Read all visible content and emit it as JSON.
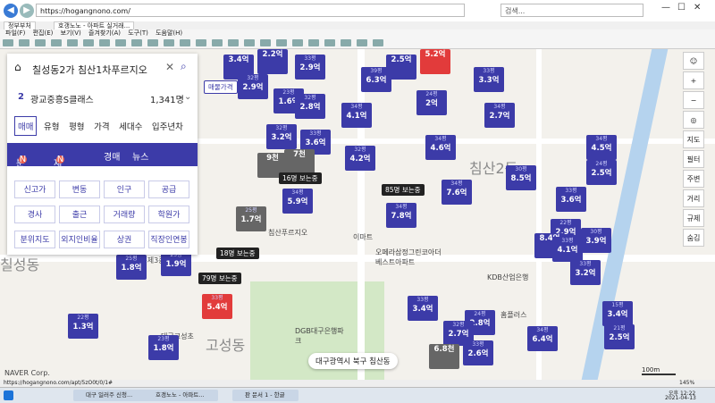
{
  "browser": {
    "url": "https://hogangnono.com/",
    "search_placeholder": "검색...",
    "tabs": [
      "정부부처",
      "호갱노노 - 아파트 실거래..."
    ],
    "menu": [
      "파일(F)",
      "편집(E)",
      "보기(V)",
      "즐겨찾기(A)",
      "도구(T)",
      "도움말(H)"
    ],
    "status_url": "https://hogangnono.com/apt/5zO0t/0/1#",
    "zoom": "145%"
  },
  "panel": {
    "search_text": "칠성동2가 침산1차푸르지오",
    "result_num": "2",
    "result_name": "광교중흥S클래스",
    "result_count": "1,341명",
    "filter_tabs": [
      "매매",
      "유형",
      "평형",
      "가격",
      "세대수",
      "입주년차"
    ],
    "purple_tabs": [
      "분양",
      "재건축",
      "경매",
      "뉴스"
    ],
    "grid": [
      "신고가",
      "변동",
      "인구",
      "공급",
      "경사",
      "출근",
      "거래량",
      "학원가",
      "분위지도",
      "외지인비율",
      "상권",
      "직장인연봉"
    ]
  },
  "markers": [
    {
      "n": "",
      "p": "2.2억"
    },
    {
      "n": "33평",
      "p": "2.9억"
    },
    {
      "n": "",
      "p": "3.4억"
    },
    {
      "n": "",
      "p": "2.5억"
    },
    {
      "n": "",
      "p": "5.2억"
    },
    {
      "n": "39평",
      "p": "6.3억"
    },
    {
      "n": "33평",
      "p": "3.3억"
    },
    {
      "n": "32평",
      "p": "2.9억"
    },
    {
      "n": "23평",
      "p": "1.6억"
    },
    {
      "n": "32평",
      "p": "2.8억"
    },
    {
      "n": "34평",
      "p": "4.1억"
    },
    {
      "n": "24평",
      "p": "2억"
    },
    {
      "n": "34평",
      "p": "2.7억"
    },
    {
      "n": "32평",
      "p": "3.2억"
    },
    {
      "n": "33평",
      "p": "3.6억"
    },
    {
      "n": "34평",
      "p": "4.6억"
    },
    {
      "n": "32평",
      "p": "4.2억"
    },
    {
      "n": "34평",
      "p": "4.5억"
    },
    {
      "n": "",
      "p": "9천"
    },
    {
      "n": "",
      "p": "7천"
    },
    {
      "n": "30평",
      "p": "8.5억"
    },
    {
      "n": "24평",
      "p": "2.5억"
    },
    {
      "n": "34평",
      "p": "7.6억"
    },
    {
      "n": "34평",
      "p": "5.9억"
    },
    {
      "n": "33평",
      "p": "3.6억"
    },
    {
      "n": "25평",
      "p": "1.7억"
    },
    {
      "n": "34평",
      "p": "7.8억"
    },
    {
      "n": "22평",
      "p": "2.9억"
    },
    {
      "n": "30평",
      "p": "3.9억"
    },
    {
      "n": "",
      "p": "8.4억"
    },
    {
      "n": "33평",
      "p": "4.1억"
    },
    {
      "n": "25평",
      "p": "1.8억"
    },
    {
      "n": "25평",
      "p": "1.9억"
    },
    {
      "n": "33평",
      "p": "3.2억"
    },
    {
      "n": "33평",
      "p": "5.4억"
    },
    {
      "n": "33평",
      "p": "3.4억"
    },
    {
      "n": "15평",
      "p": "3.4억"
    },
    {
      "n": "22평",
      "p": "1.3억"
    },
    {
      "n": "24평",
      "p": "2.8억"
    },
    {
      "n": "32평",
      "p": "2.7억"
    },
    {
      "n": "34평",
      "p": "6.4억"
    },
    {
      "n": "23평",
      "p": "1.8억"
    },
    {
      "n": "",
      "p": "6.8천"
    },
    {
      "n": "33평",
      "p": "2.6억"
    },
    {
      "n": "21평",
      "p": "2.5억"
    }
  ],
  "tags": [
    "매물가격",
    "16명 보는중",
    "85명 보는중",
    "18명 보는중",
    "79명 보는중"
  ],
  "places": [
    "칠성동",
    "침산2동",
    "고성동",
    "대구제3중",
    "NAVER Corp.",
    "대구광역시 북구 침산동",
    "이마트",
    "홈플러스",
    "DGB대구은행파크",
    "침산푸르지오",
    "오페라삼정그린코아더베스트아파트",
    "KDB산업은행",
    "대구고성초"
  ],
  "right_tools": [
    "지도",
    "필터",
    "주변",
    "거리",
    "규제",
    "숨김"
  ],
  "scale": "100m",
  "taskbar": {
    "tasks": [
      "대구 일러주 신청...",
      "호갱노노 - 아파트...",
      "판 문서 1 - 한글"
    ],
    "time": "오후 12:22",
    "date": "2021-04-13"
  }
}
